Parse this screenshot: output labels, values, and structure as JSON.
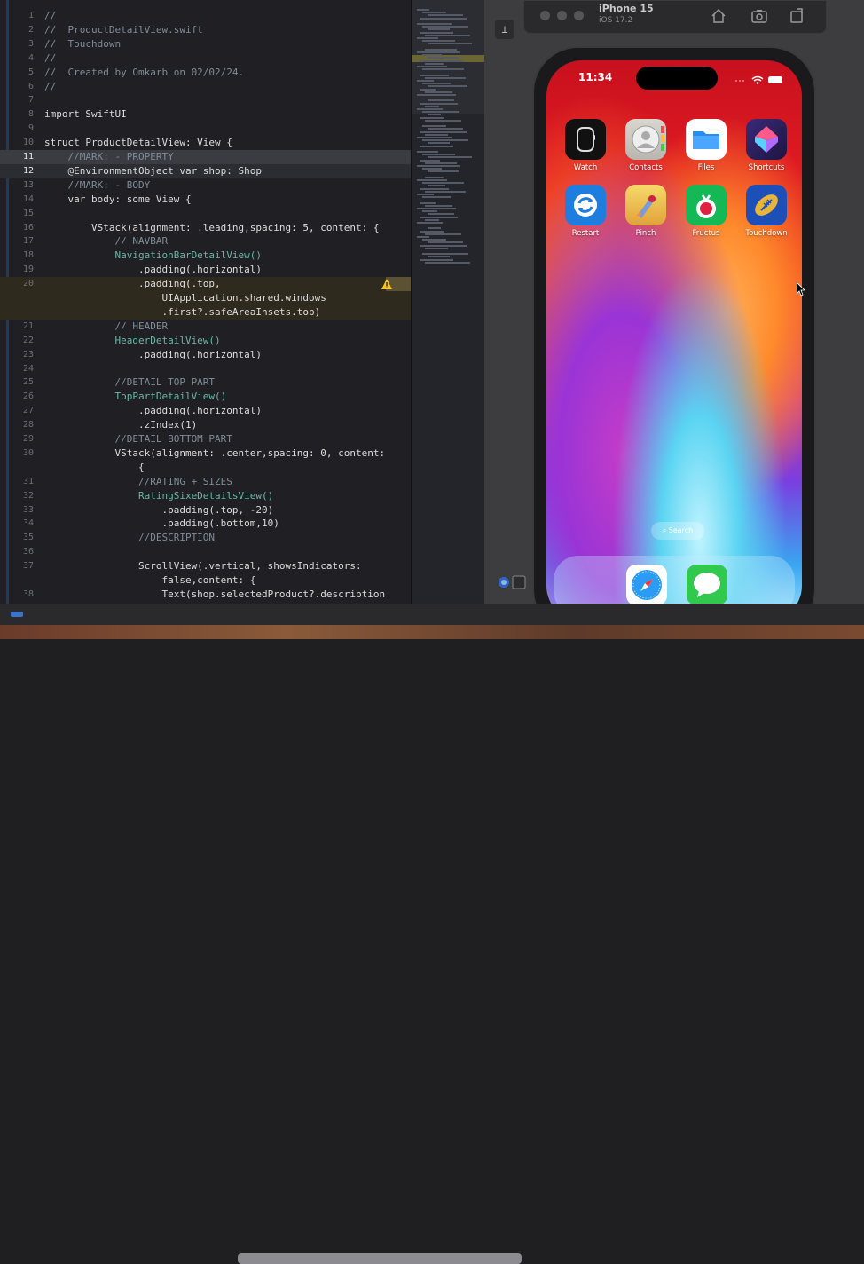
{
  "editor": {
    "lines": [
      {
        "n": "1",
        "text": "//",
        "cls": "cm"
      },
      {
        "n": "2",
        "text": "//  ProductDetailView.swift",
        "cls": "cm"
      },
      {
        "n": "3",
        "text": "//  Touchdown",
        "cls": "cm"
      },
      {
        "n": "4",
        "text": "//",
        "cls": "cm"
      },
      {
        "n": "5",
        "text": "//  Created by Omkarb on 02/02/24.",
        "cls": "cm"
      },
      {
        "n": "6",
        "text": "//",
        "cls": "cm"
      },
      {
        "n": "7",
        "text": "",
        "cls": ""
      },
      {
        "n": "8",
        "text": "import SwiftUI",
        "cls": "import"
      },
      {
        "n": "9",
        "text": "",
        "cls": ""
      },
      {
        "n": "10",
        "text": "struct ProductDetailView: View {",
        "cls": "struct"
      },
      {
        "n": "11",
        "text": "    //MARK: - PROPERTY",
        "cls": "cm"
      },
      {
        "n": "12",
        "text": "    @EnvironmentObject var shop: Shop",
        "cls": "env"
      },
      {
        "n": "13",
        "text": "    //MARK: - BODY",
        "cls": "cm"
      },
      {
        "n": "14",
        "text": "    var body: some View {",
        "cls": "body"
      },
      {
        "n": "15",
        "text": "",
        "cls": ""
      },
      {
        "n": "16",
        "text": "        VStack(alignment: .leading,spacing: 5, content: {",
        "cls": "code"
      },
      {
        "n": "17",
        "text": "            // NAVBAR",
        "cls": "cm"
      },
      {
        "n": "18",
        "text": "            NavigationBarDetailView()",
        "cls": "fn"
      },
      {
        "n": "19",
        "text": "                .padding(.horizontal)",
        "cls": "code"
      },
      {
        "n": "20",
        "text": "                .padding(.top,",
        "cls": "code"
      },
      {
        "n": "",
        "text": "                    UIApplication.shared.windows",
        "cls": "code"
      },
      {
        "n": "",
        "text": "                    .first?.safeAreaInsets.top)",
        "cls": "code"
      },
      {
        "n": "21",
        "text": "            // HEADER",
        "cls": "cm"
      },
      {
        "n": "22",
        "text": "            HeaderDetailView()",
        "cls": "fn"
      },
      {
        "n": "23",
        "text": "                .padding(.horizontal)",
        "cls": "code"
      },
      {
        "n": "24",
        "text": "",
        "cls": ""
      },
      {
        "n": "25",
        "text": "            //DETAIL TOP PART",
        "cls": "cm"
      },
      {
        "n": "26",
        "text": "            TopPartDetailView()",
        "cls": "fn"
      },
      {
        "n": "27",
        "text": "                .padding(.horizontal)",
        "cls": "code"
      },
      {
        "n": "28",
        "text": "                .zIndex(1)",
        "cls": "code"
      },
      {
        "n": "29",
        "text": "            //DETAIL BOTTOM PART",
        "cls": "cm"
      },
      {
        "n": "30",
        "text": "            VStack(alignment: .center,spacing: 0, content:",
        "cls": "code"
      },
      {
        "n": "",
        "text": "                {",
        "cls": "code"
      },
      {
        "n": "31",
        "text": "                //RATING + SIZES",
        "cls": "cm"
      },
      {
        "n": "32",
        "text": "                RatingSixeDetailsView()",
        "cls": "fn"
      },
      {
        "n": "33",
        "text": "                    .padding(.top, -20)",
        "cls": "code"
      },
      {
        "n": "34",
        "text": "                    .padding(.bottom,10)",
        "cls": "code"
      },
      {
        "n": "35",
        "text": "                //DESCRIPTION",
        "cls": "cm"
      },
      {
        "n": "36",
        "text": "",
        "cls": ""
      },
      {
        "n": "37",
        "text": "                ScrollView(.vertical, showsIndicators:",
        "cls": "code"
      },
      {
        "n": "",
        "text": "                    false,content: {",
        "cls": "code"
      },
      {
        "n": "38",
        "text": "                    Text(shop.selectedProduct?.description",
        "cls": "code"
      }
    ]
  },
  "simulator": {
    "device": "iPhone 15",
    "os": "iOS 17.2"
  },
  "phone": {
    "time": "11:34",
    "apps_row1": [
      {
        "label": "Watch",
        "icon": "watch-icon"
      },
      {
        "label": "Contacts",
        "icon": "contacts-icon"
      },
      {
        "label": "Files",
        "icon": "files-icon"
      },
      {
        "label": "Shortcuts",
        "icon": "shortcuts-icon"
      }
    ],
    "apps_row2": [
      {
        "label": "Restart",
        "icon": "restart-icon"
      },
      {
        "label": "Pinch",
        "icon": "pinch-icon"
      },
      {
        "label": "Fructus",
        "icon": "fructus-icon"
      },
      {
        "label": "Touchdown",
        "icon": "touchdown-icon"
      }
    ],
    "search": "Search",
    "dock": [
      {
        "icon": "safari-icon"
      },
      {
        "icon": "messages-icon"
      }
    ]
  }
}
